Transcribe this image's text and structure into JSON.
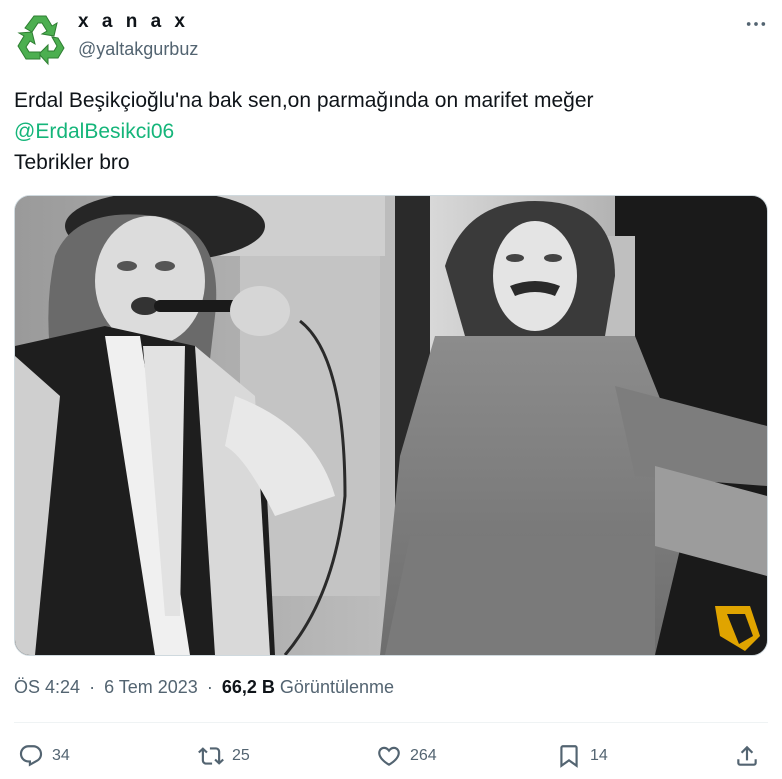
{
  "author": {
    "display_name": "x a n a x",
    "handle": "@yaltakgurbuz"
  },
  "icons": {
    "avatar": "recycle-icon",
    "more": "more-horizontal-icon",
    "reply": "reply-icon",
    "retweet": "retweet-icon",
    "like": "heart-icon",
    "bookmark": "bookmark-icon",
    "share": "share-icon"
  },
  "tweet": {
    "line1": "Erdal Beşikçioğlu'na bak sen,on parmağında on marifet meğer",
    "mention": "@ErdalBesikci06",
    "line3": "Tebrikler bro"
  },
  "meta": {
    "time": "ÖS 4:24",
    "separator": "·",
    "date": "6 Tem 2023",
    "views_count": "66,2 B",
    "views_label": "Görüntülenme"
  },
  "actions": {
    "replies": "34",
    "retweets": "25",
    "likes": "264",
    "bookmarks": "14"
  },
  "colors": {
    "mention": "#15b57a",
    "secondary_text": "#536471",
    "avatar_green": "#4caf50"
  }
}
